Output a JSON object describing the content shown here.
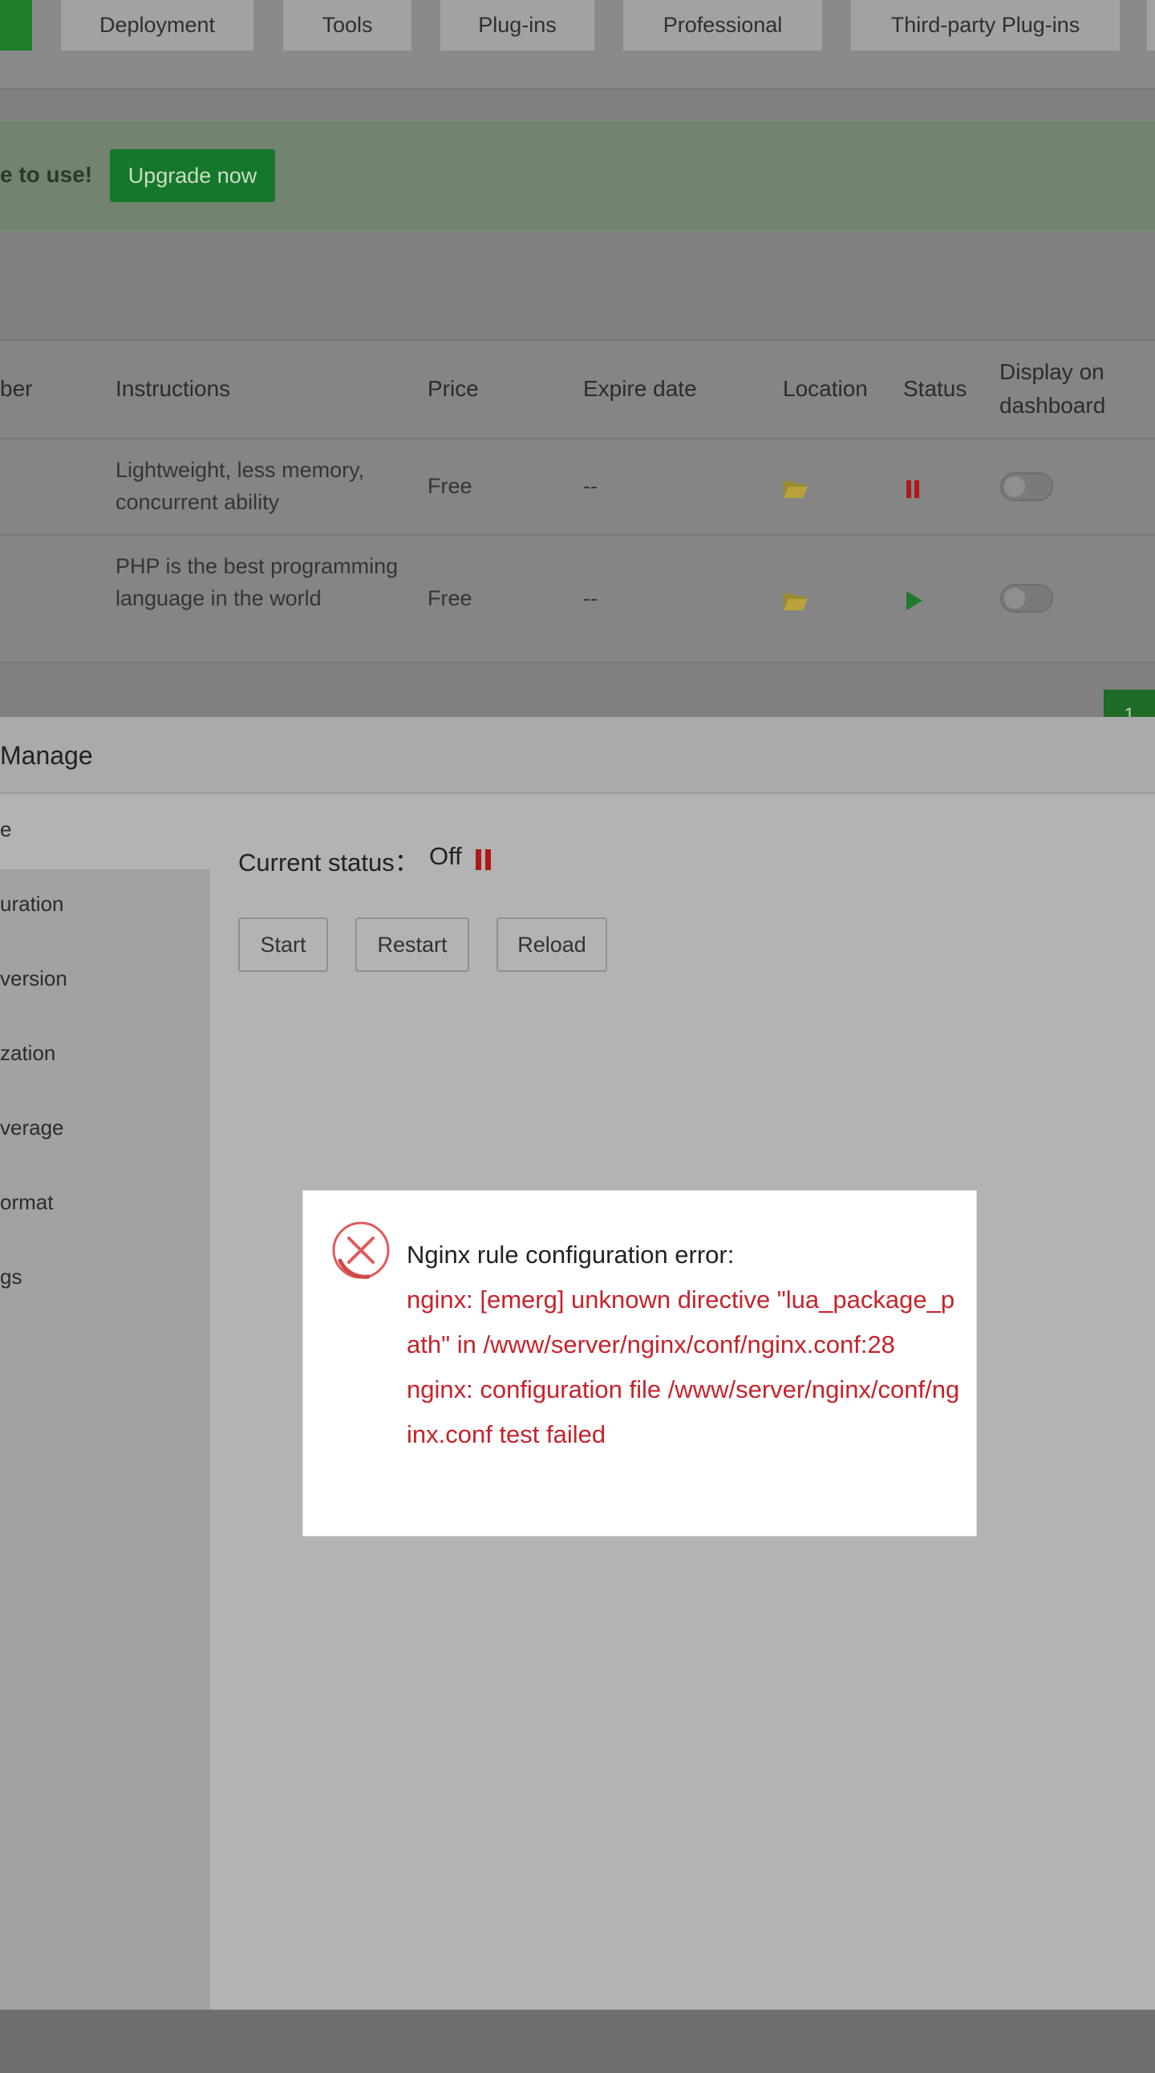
{
  "nav_tabs": [
    "Deployment",
    "Tools",
    "Plug-ins",
    "Professional",
    "Third-party Plug-ins"
  ],
  "promo": {
    "text": "e to use!",
    "button": "Upgrade now"
  },
  "table": {
    "headers": [
      "ber",
      "Instructions",
      "Price",
      "Expire date",
      "Location",
      "Status",
      "Display on dashboard"
    ],
    "rows": [
      {
        "instructions": "Lightweight, less memory, concurrent ability",
        "price": "Free",
        "expire": "--",
        "status": "paused",
        "on_dashboard": false
      },
      {
        "instructions": "PHP is the best programming language in the world",
        "price": "Free",
        "expire": "--",
        "status": "running",
        "on_dashboard": false
      }
    ]
  },
  "pagination": {
    "current": "1"
  },
  "manage": {
    "title": "Manage",
    "sidebar": [
      "e",
      "uration",
      " version",
      "zation",
      "verage",
      "ormat",
      "gs"
    ],
    "status_label": "Current status：",
    "status_value": "Off",
    "buttons": [
      "Start",
      "Restart",
      "Reload"
    ]
  },
  "dialog": {
    "heading": "Nginx rule configuration error:",
    "error_line_1": "nginx: [emerg] unknown directive \"lua_package_path\" in /www/server/nginx/conf/nginx.conf:28",
    "error_line_2": "nginx: configuration file /www/server/nginx/conf/nginx.conf test failed"
  },
  "colors": {
    "accent_green": "#1e7e2a",
    "error_red": "#c8222a",
    "folder_yellow": "#b8a23a",
    "pause_red": "#b01818",
    "play_green": "#1f7a2e"
  },
  "icons": {
    "error": "error-circle-x-icon",
    "folder": "folder-open-icon",
    "pause": "pause-icon",
    "play": "play-icon"
  }
}
